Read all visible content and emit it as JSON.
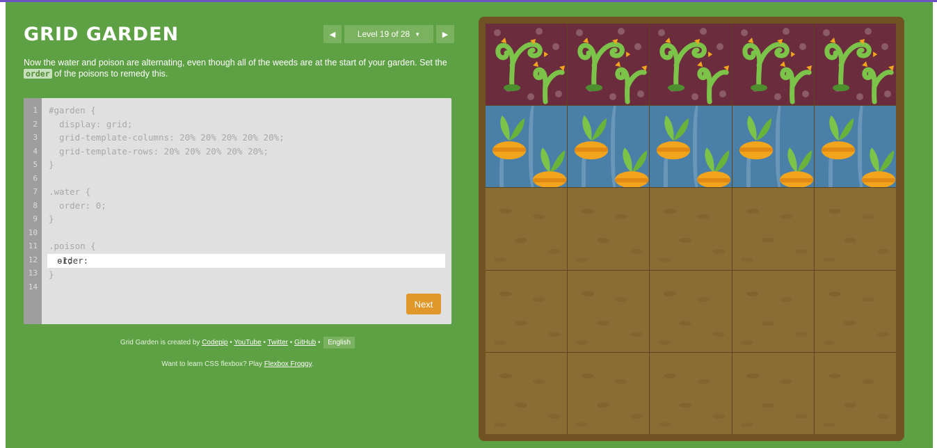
{
  "header": {
    "title": "GRID GARDEN",
    "level_label": "Level 19 of 28",
    "prev_icon": "triangle-left",
    "next_icon": "triangle-right",
    "dropdown_icon": "caret-down"
  },
  "instructions": {
    "text_before": "Now the water and poison are alternating, even though all of the weeds are at the start of your garden. Set the ",
    "code": "order",
    "text_after": " of the poisons to remedy this."
  },
  "editor": {
    "line_numbers": [
      "1",
      "2",
      "3",
      "4",
      "5",
      "6",
      "7",
      "8",
      "9",
      "10",
      "11",
      "12",
      "13",
      "14"
    ],
    "lines_before": "#garden {\n  display: grid;\n  grid-template-columns: 20% 20% 20% 20% 20%;\n  grid-template-rows: 20% 20% 20% 20% 20%;\n}\n\n.water {\n  order: 0;\n}\n\n.poison {",
    "input_prefix": "order: ",
    "input_value": "-1;",
    "lines_after": "}",
    "next_label": "Next"
  },
  "footer": {
    "credit_prefix": "Grid Garden is created by ",
    "credit_author": "Codepip",
    "sep": " • ",
    "link_youtube": "YouTube",
    "link_twitter": "Twitter",
    "link_github": "GitHub",
    "language": "English",
    "promo_text": "Want to learn CSS flexbox? Play ",
    "promo_link": "Flexbox Froggy",
    "promo_end": "."
  },
  "garden": {
    "columns": 5,
    "rows": 5,
    "poison_row": 1,
    "water_row": 2,
    "poison_count": 5,
    "water_count": 5,
    "poison_icon": "weed-icon",
    "water_icon": "carrot-icon"
  },
  "colors": {
    "background": "#5ea144",
    "accent_button": "#e1982a",
    "water": "#4a7fa8",
    "poison": "#6b2d3d",
    "soil": "#8a6d35",
    "frame": "#6f5322"
  }
}
